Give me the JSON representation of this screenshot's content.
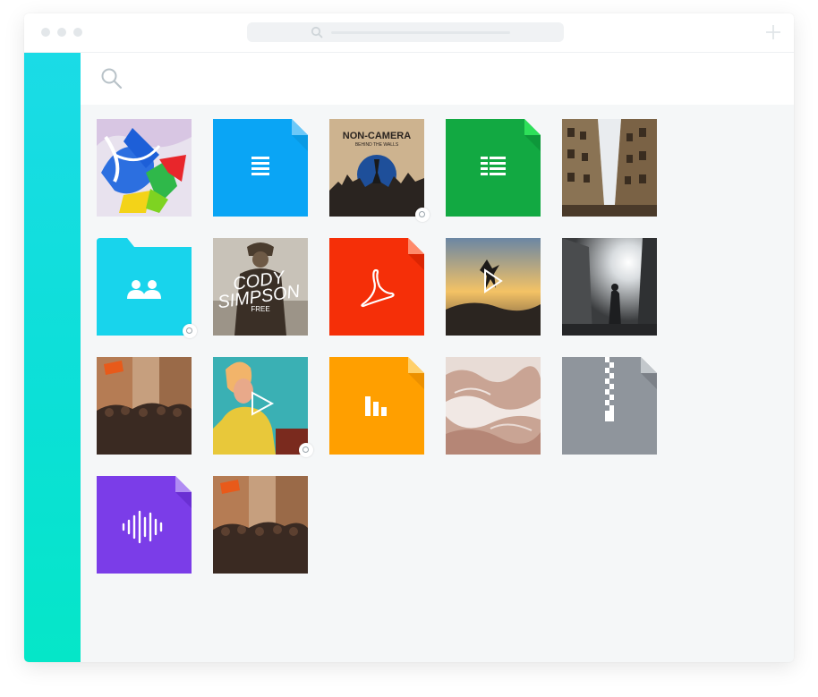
{
  "window": {
    "traffic_lights": [
      "dot",
      "dot",
      "dot"
    ],
    "url_bar": "",
    "new_tab": "plus-icon"
  },
  "search": {
    "icon": "search-icon",
    "placeholder": ""
  },
  "colors": {
    "sidebar_top": "#1bdbe6",
    "sidebar_bottom": "#05e6c8",
    "doc_blue": "#0aa5f5",
    "sheet_green": "#12a942",
    "folder_cyan": "#18d4ec",
    "pdf_red": "#f52f08",
    "slides_orange": "#ff9f00",
    "zip_gray": "#8f959c",
    "audio_purple": "#7b3de8"
  },
  "files": [
    {
      "kind": "image",
      "name": "album-art-abstract"
    },
    {
      "kind": "document",
      "icon": "document-icon"
    },
    {
      "kind": "image",
      "name": "non-camera-poster",
      "caption_line1": "NON-CAMERA",
      "caption_line2": "BEHIND THE WALLS",
      "shared": true
    },
    {
      "kind": "spreadsheet",
      "icon": "spreadsheet-icon"
    },
    {
      "kind": "image",
      "name": "street-buildings-photo"
    },
    {
      "kind": "folder",
      "icon": "shared-users-icon",
      "shared": true
    },
    {
      "kind": "image",
      "name": "cody-simpson-cover",
      "caption_line1": "CODY",
      "caption_line2": "SIMPSON",
      "caption_line3": "FREE"
    },
    {
      "kind": "pdf",
      "icon": "acrobat-icon"
    },
    {
      "kind": "video",
      "name": "sunset-jump-video"
    },
    {
      "kind": "image",
      "name": "sunlit-street-photo"
    },
    {
      "kind": "image",
      "name": "crowd-street-photo"
    },
    {
      "kind": "video",
      "name": "phone-call-video",
      "shared": true
    },
    {
      "kind": "presentation",
      "icon": "bar-chart-icon"
    },
    {
      "kind": "image",
      "name": "water-texture-photo"
    },
    {
      "kind": "archive",
      "icon": "zipper-icon"
    },
    {
      "kind": "audio",
      "icon": "waveform-icon"
    },
    {
      "kind": "image",
      "name": "crowd-street-photo-2"
    }
  ]
}
